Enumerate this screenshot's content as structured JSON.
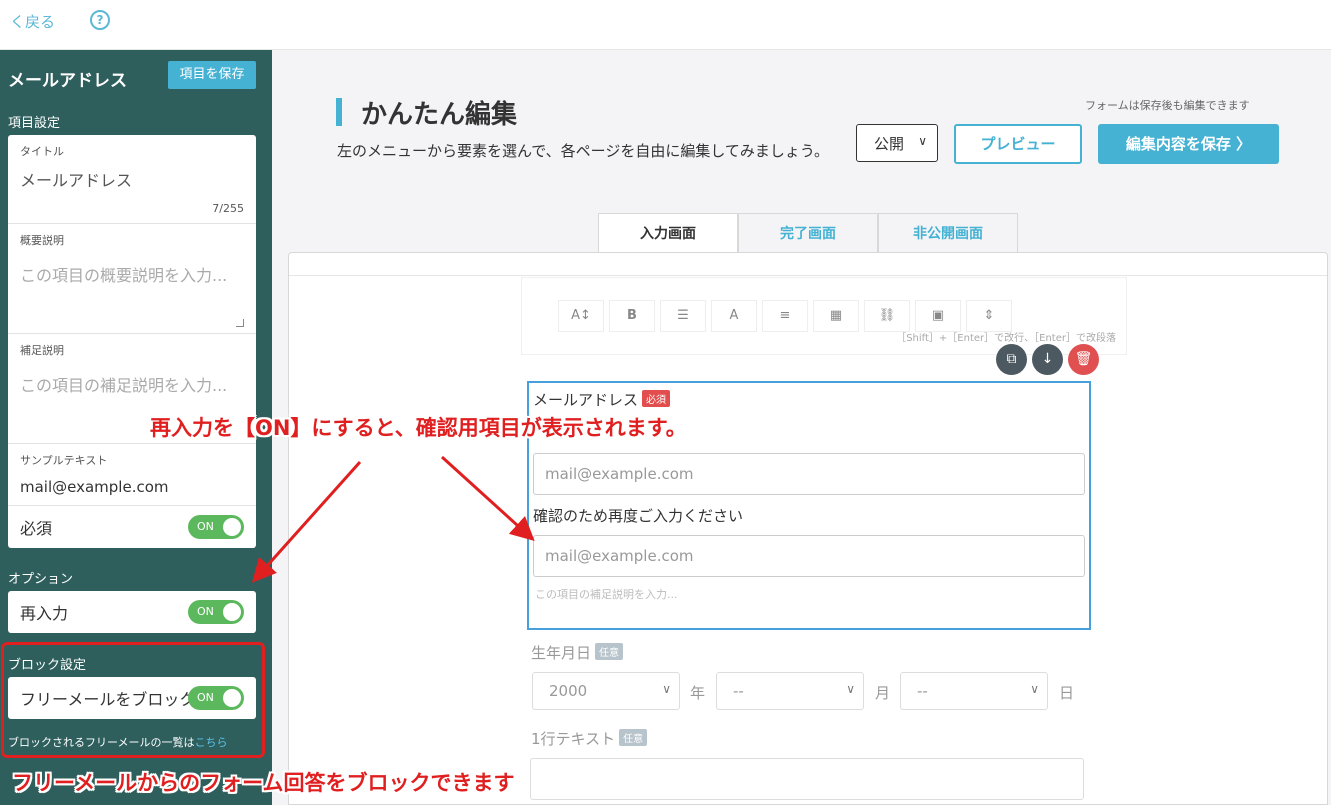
{
  "topbar": {
    "back_label": "く戻る",
    "help_glyph": "?"
  },
  "sidebar": {
    "title": "メールアドレス",
    "save_label": "項目を保存",
    "item_settings_heading": "項目設定",
    "fields": {
      "title": {
        "label": "タイトル",
        "value": "メールアドレス",
        "counter": "7/255"
      },
      "summary": {
        "label": "概要説明",
        "placeholder": "この項目の概要説明を入力..."
      },
      "supplement": {
        "label": "補足説明",
        "placeholder": "この項目の補足説明を入力..."
      },
      "sample": {
        "label": "サンプルテキスト",
        "value": "mail@example.com"
      }
    },
    "required": {
      "label": "必須",
      "toggle": "ON"
    },
    "options_heading": "オプション",
    "reenter": {
      "label": "再入力",
      "toggle": "ON"
    },
    "block_heading": "ブロック設定",
    "block_free": {
      "label": "フリーメールをブロック",
      "toggle": "ON"
    },
    "block_list_text": "ブロックされるフリーメールの一覧は",
    "block_list_link": "こちら"
  },
  "header": {
    "title": "かんたん編集",
    "description": "左のメニューから要素を選んで、各ページを自由に編集してみましょう。",
    "note": "フォームは保存後も編集できます",
    "publish_value": "公開",
    "preview_label": "プレビュー",
    "save_label": "編集内容を保存 〉"
  },
  "tabs": [
    {
      "label": "入力画面",
      "active": true
    },
    {
      "label": "完了画面",
      "active": false
    },
    {
      "label": "非公開画面",
      "active": false
    }
  ],
  "toolbar": {
    "buttons": [
      "A↕",
      "B",
      "☰",
      "A",
      "≡",
      "▦",
      "⛓",
      "▣",
      "⇕"
    ],
    "hint": "［Shift］+［Enter］で改行、［Enter］で改段落"
  },
  "block_actions": {
    "copy": "⧉",
    "down": "↓",
    "delete": "🗑"
  },
  "selected_block": {
    "label": "メールアドレス",
    "required_badge": "必須",
    "placeholder": "mail@example.com",
    "confirm_label": "確認のため再度ご入力ください",
    "confirm_placeholder": "mail@example.com",
    "help_placeholder": "この項目の補足説明を入力..."
  },
  "birthday": {
    "label": "生年月日",
    "badge": "任意",
    "year": "2000",
    "year_unit": "年",
    "month": "--",
    "month_unit": "月",
    "day": "--",
    "day_unit": "日"
  },
  "single_line": {
    "label": "1行テキスト",
    "badge": "任意"
  },
  "annotations": {
    "top": "再入力を【ON】にすると、確認用項目が表示されます。",
    "bottom": "フリーメールからのフォーム回答をブロックできます"
  },
  "colors": {
    "sidebar_bg": "#2e5f5d",
    "accent": "#45b2d3",
    "toggle_on": "#5cb85c",
    "annotation_red": "#e02020",
    "required_red": "#e24e4e"
  }
}
